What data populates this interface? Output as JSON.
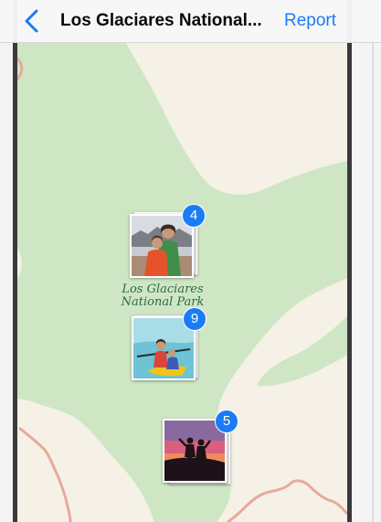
{
  "nav": {
    "back_icon": "chevron-left-icon",
    "title": "Los Glaciares National...",
    "report_label": "Report",
    "accent_color": "#1a7cf5"
  },
  "map": {
    "park_label": "Los Glaciares National Park",
    "colors": {
      "land": "#f5f1e7",
      "park": "#cfe6c4",
      "border_line": "#e8a99a"
    },
    "clusters": [
      {
        "count": "4",
        "photo": "two people on lakeshore with mountains"
      },
      {
        "count": "9",
        "photo": "people in yellow kayak on turquoise water"
      },
      {
        "count": "5",
        "photo": "two silhouettes at sunset"
      }
    ]
  }
}
